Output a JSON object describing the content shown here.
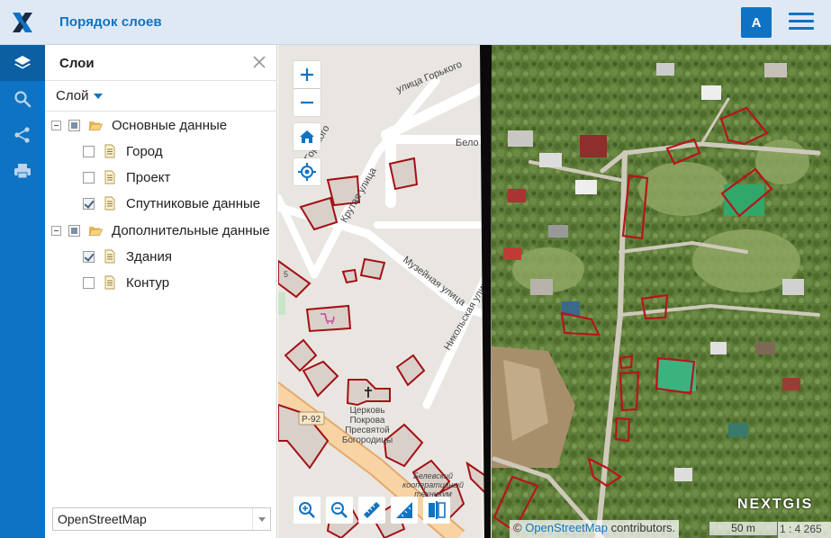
{
  "header": {
    "title": "Порядок слоев",
    "user_initial": "A",
    "accent_color": "#0f73c3"
  },
  "rail": {
    "items": [
      "layers-icon",
      "search-icon",
      "share-icon",
      "print-icon"
    ]
  },
  "panel": {
    "title": "Слои",
    "menu_label": "Слой",
    "tree": [
      {
        "label": "Основные данные",
        "type": "group",
        "state": "partial"
      },
      {
        "label": "Город",
        "type": "layer",
        "checked": false
      },
      {
        "label": "Проект",
        "type": "layer",
        "checked": false
      },
      {
        "label": "Спутниковые данные",
        "type": "layer",
        "checked": true
      },
      {
        "label": "Дополнительные данные",
        "type": "group",
        "state": "partial"
      },
      {
        "label": "Здания",
        "type": "layer",
        "checked": true
      },
      {
        "label": "Контур",
        "type": "layer",
        "checked": false
      }
    ],
    "basemap": "OpenStreetMap"
  },
  "map": {
    "street_labels": {
      "gorkogo": "улица Горького",
      "gorkogo2": "Горького",
      "krutaya": "Крутая улица",
      "muzeynaya": "Музейная улица",
      "nikolskaya": "Никольская улица",
      "bel": "Бело",
      "road": "Р-92",
      "church": [
        "Церковь",
        "Покрова",
        "Пресвятой",
        "Богородицы"
      ],
      "bel2": [
        "Белевский",
        "кооперативный",
        "техникум"
      ],
      "num5": "5"
    },
    "attribution_prefix": "©",
    "attribution_link": "OpenStreetMap",
    "attribution_suffix": "contributors.",
    "scale_label": "50 m",
    "ratio_label": "1 : 4 265",
    "brand": "NEXTGIS"
  }
}
